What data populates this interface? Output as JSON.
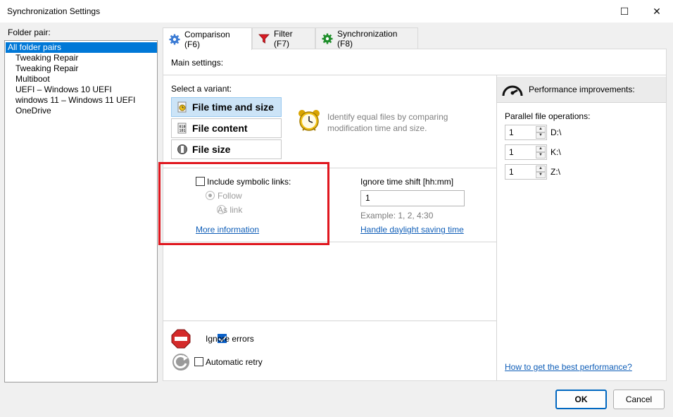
{
  "window": {
    "title": "Synchronization Settings",
    "minimize": "—",
    "maximize": "☐",
    "close": "✕"
  },
  "folder_pair": {
    "label": "Folder pair:",
    "items": [
      "All folder pairs",
      "Tweaking Repair",
      "Tweaking Repair",
      "Multiboot",
      "UEFI – Windows 10 UEFI",
      "windows 11 – Windows 11 UEFI",
      "OneDrive"
    ]
  },
  "tabs": [
    {
      "label": "Comparison (F6)",
      "icon": "gear-icon"
    },
    {
      "label": "Filter (F7)",
      "icon": "filter-icon"
    },
    {
      "label": "Synchronization (F8)",
      "icon": "green-gear-icon"
    }
  ],
  "main": {
    "heading": "Main settings:",
    "select_variant": "Select a variant:",
    "variants": [
      {
        "label": "File time and size",
        "icon": "clock-file-icon",
        "active": true
      },
      {
        "label": "File content",
        "icon": "binary-file-icon",
        "active": false
      },
      {
        "label": "File size",
        "icon": "size-file-icon",
        "active": false
      }
    ],
    "variant_description": "Identify equal files by comparing modification time and size.",
    "symlinks": {
      "label": "Include symbolic links:",
      "options": [
        "Follow",
        "As link"
      ],
      "more_info": "More information"
    },
    "time_shift": {
      "label": "Ignore time shift [hh:mm]",
      "value": "1",
      "example": "Example:  1, 2, 4:30",
      "dst_link": "Handle daylight saving time"
    },
    "ignore_errors": "Ignore errors",
    "automatic_retry": "Automatic retry"
  },
  "performance": {
    "heading": "Performance improvements:",
    "parallel_label": "Parallel file operations:",
    "drives": [
      {
        "value": "1",
        "drive": "D:\\"
      },
      {
        "value": "1",
        "drive": "K:\\"
      },
      {
        "value": "1",
        "drive": "Z:\\"
      }
    ],
    "link": "How to get the best performance?"
  },
  "buttons": {
    "ok": "OK",
    "cancel": "Cancel"
  },
  "colors": {
    "accent": "#0078d7",
    "highlight_box": "#e0161e",
    "link": "#0f5eb8"
  }
}
